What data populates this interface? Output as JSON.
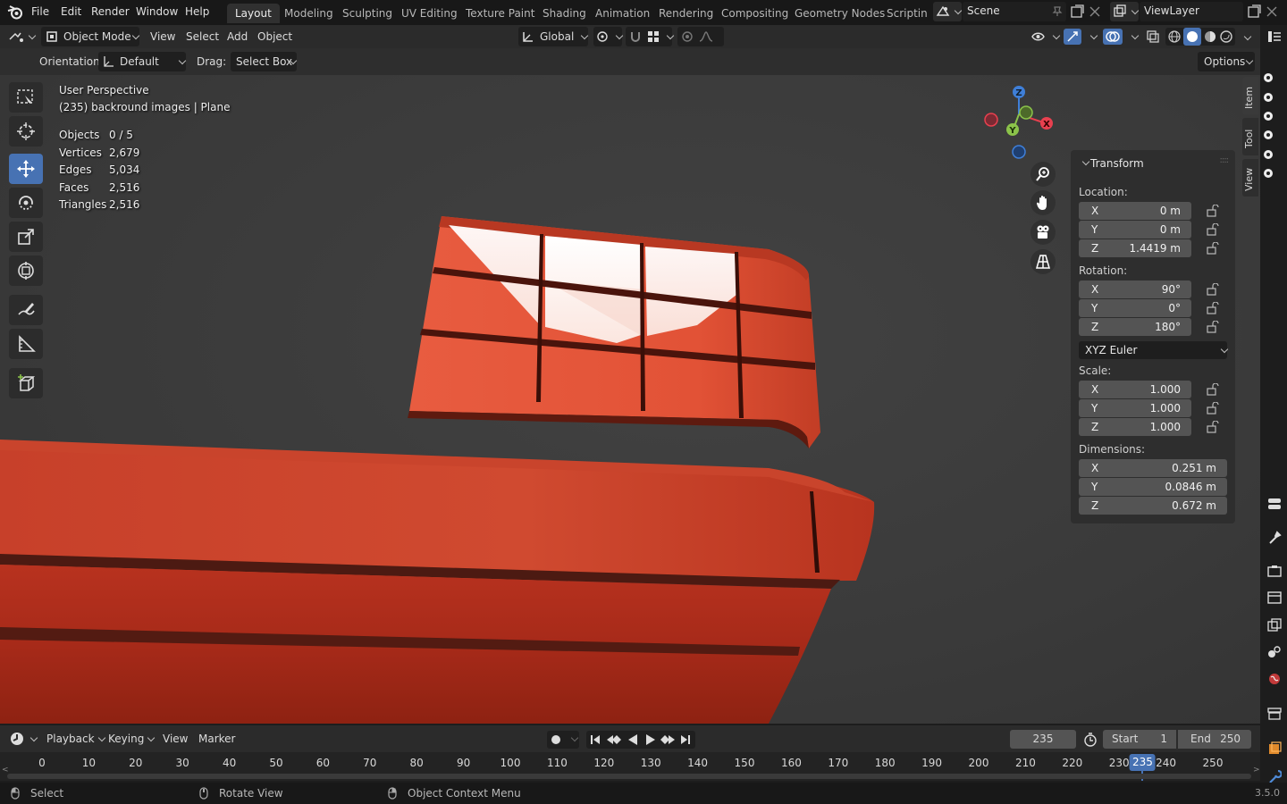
{
  "app": {
    "version": "3.5.0"
  },
  "menu": [
    "File",
    "Edit",
    "Render",
    "Window",
    "Help"
  ],
  "workspaces": [
    "Layout",
    "Modeling",
    "Sculpting",
    "UV Editing",
    "Texture Paint",
    "Shading",
    "Animation",
    "Rendering",
    "Compositing",
    "Geometry Nodes",
    "Scripting"
  ],
  "active_workspace": "Layout",
  "scene": "Scene",
  "view_layer": "ViewLayer",
  "viewport_header": {
    "mode": "Object Mode",
    "menus": [
      "View",
      "Select",
      "Add",
      "Object"
    ],
    "transform_orientation": "Global"
  },
  "tool_settings": {
    "orientation_label": "Orientation:",
    "orientation_value": "Default",
    "drag_label": "Drag:",
    "drag_value": "Select Box",
    "options": "Options"
  },
  "overlay": {
    "view_name": "User Perspective",
    "object_info": "(235) backround images | Plane",
    "stats": [
      {
        "label": "Objects",
        "value": "0 / 5"
      },
      {
        "label": "Vertices",
        "value": "2,679"
      },
      {
        "label": "Edges",
        "value": "5,034"
      },
      {
        "label": "Faces",
        "value": "2,516"
      },
      {
        "label": "Triangles",
        "value": "2,516"
      }
    ]
  },
  "gizmo_axes": {
    "x": "X",
    "y": "Y",
    "z": "Z"
  },
  "npanel": {
    "title": "Transform",
    "location_label": "Location:",
    "location": [
      {
        "axis": "X",
        "value": "0 m"
      },
      {
        "axis": "Y",
        "value": "0 m"
      },
      {
        "axis": "Z",
        "value": "1.4419 m"
      }
    ],
    "rotation_label": "Rotation:",
    "rotation": [
      {
        "axis": "X",
        "value": "90°"
      },
      {
        "axis": "Y",
        "value": "0°"
      },
      {
        "axis": "Z",
        "value": "180°"
      }
    ],
    "rotation_mode": "XYZ Euler",
    "scale_label": "Scale:",
    "scale": [
      {
        "axis": "X",
        "value": "1.000"
      },
      {
        "axis": "Y",
        "value": "1.000"
      },
      {
        "axis": "Z",
        "value": "1.000"
      }
    ],
    "dimensions_label": "Dimensions:",
    "dimensions": [
      {
        "axis": "X",
        "value": "0.251 m"
      },
      {
        "axis": "Y",
        "value": "0.0846 m"
      },
      {
        "axis": "Z",
        "value": "0.672 m"
      }
    ],
    "tabs": [
      "Item",
      "Tool",
      "View"
    ]
  },
  "timeline": {
    "menus": [
      "Playback",
      "Keying",
      "View",
      "Marker"
    ],
    "current_frame": "235",
    "start_label": "Start",
    "start": "1",
    "end_label": "End",
    "end": "250",
    "ruler": [
      "0",
      "10",
      "20",
      "30",
      "40",
      "50",
      "60",
      "70",
      "80",
      "90",
      "100",
      "110",
      "120",
      "130",
      "140",
      "150",
      "160",
      "170",
      "180",
      "190",
      "200",
      "210",
      "220",
      "230",
      "240",
      "250"
    ]
  },
  "statusbar": {
    "select": "Select",
    "rotate": "Rotate View",
    "context": "Object Context Menu"
  },
  "colors": {
    "accent": "#4772b3",
    "object_red": "#d9482c",
    "x_axis": "#e8404f",
    "y_axis": "#8bc34a",
    "z_axis": "#3f7fd8"
  }
}
